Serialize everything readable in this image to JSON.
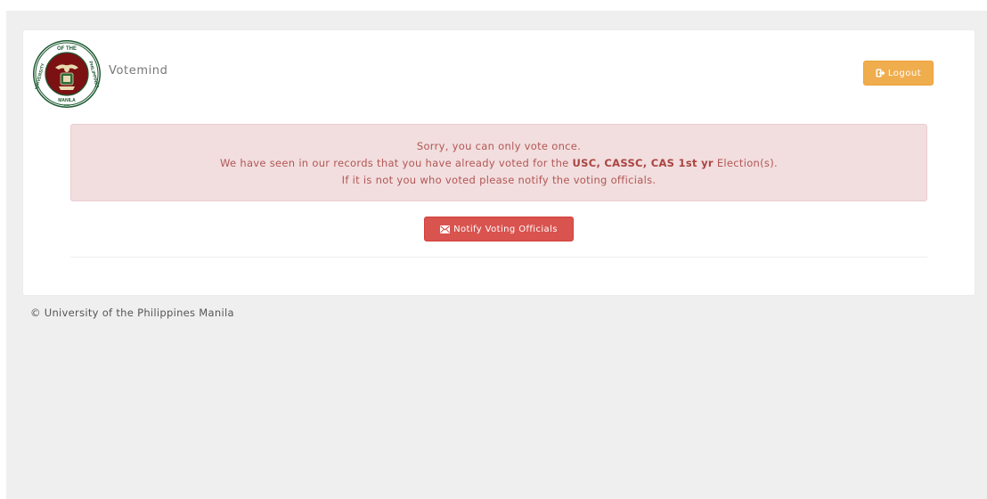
{
  "header": {
    "brand": "Votemind",
    "seal": {
      "top_text": "OF THE",
      "left_text": "UNIVERSITY",
      "right_text": "PHILIPPINES",
      "bottom_text": "MANILA",
      "year": "1908"
    },
    "logout_label": "Logout"
  },
  "alert": {
    "line1": "Sorry, you can only vote once.",
    "line2_prefix": "We have seen in our records that you have already voted for the ",
    "line2_elections": "USC, CASSC, CAS 1st yr",
    "line2_suffix": " Election(s).",
    "line3": "If it is not you who voted please notify the voting officials."
  },
  "actions": {
    "notify_label": "Notify Voting Officials"
  },
  "footer": {
    "text": "© University of the Philippines Manila"
  },
  "colors": {
    "page_bg": "#efefef",
    "alert_bg": "#f2dede",
    "alert_text": "#a94442",
    "logout_button": "#f0ad4e",
    "notify_button": "#d9534f",
    "seal_maroon": "#7b1113",
    "seal_green": "#1e5a32"
  },
  "icons": {
    "logout": "sign-out-icon",
    "notify": "envelope-icon"
  }
}
